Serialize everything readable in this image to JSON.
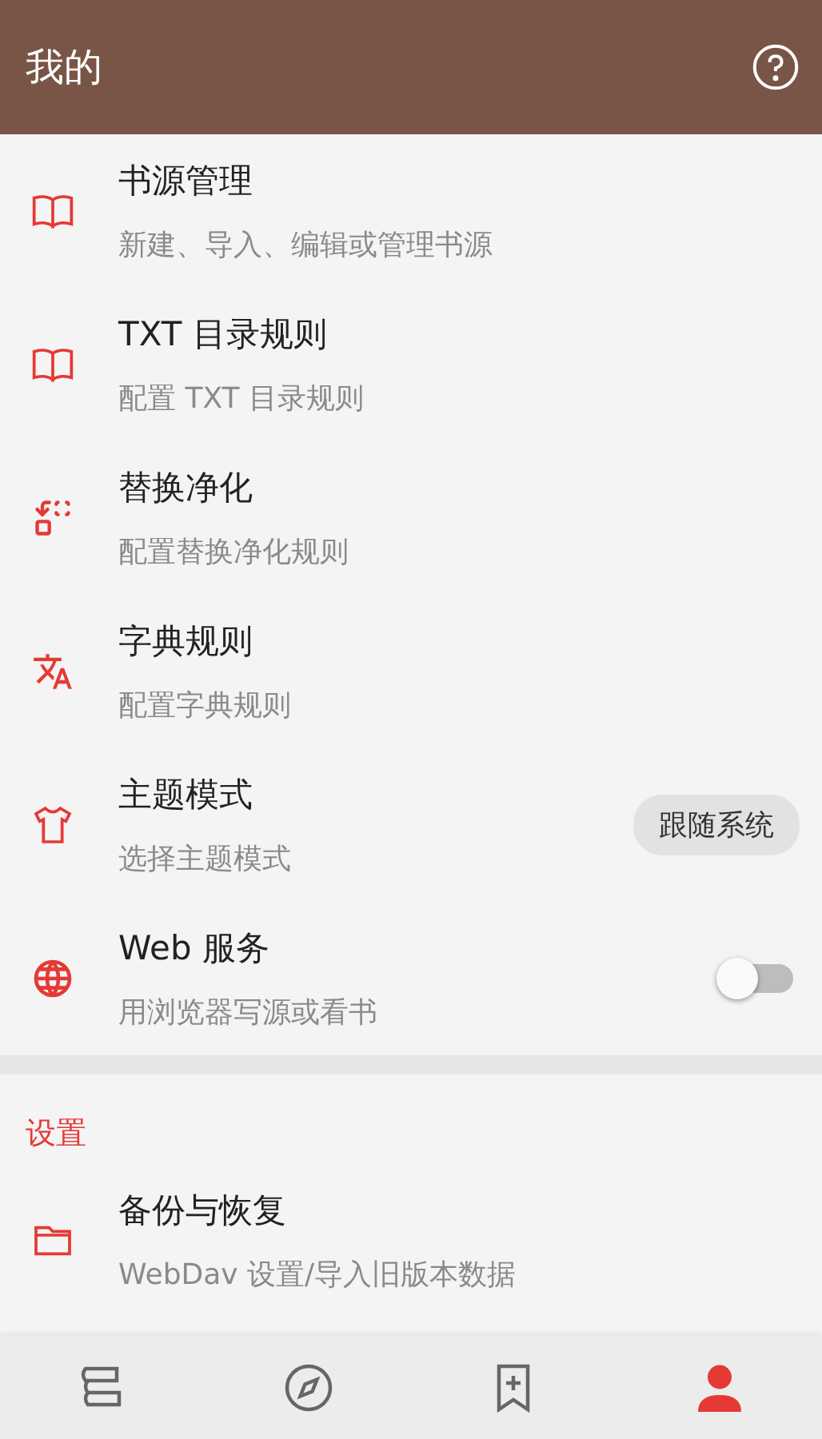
{
  "header": {
    "title": "我的"
  },
  "items": [
    {
      "kind": "plain",
      "title": "书源管理",
      "subtitle": "新建、导入、编辑或管理书源"
    },
    {
      "kind": "plain",
      "title": "TXT 目录规则",
      "subtitle": "配置 TXT 目录规则"
    },
    {
      "kind": "plain",
      "title": "替换净化",
      "subtitle": "配置替换净化规则"
    },
    {
      "kind": "plain",
      "title": "字典规则",
      "subtitle": "配置字典规则"
    },
    {
      "kind": "chip",
      "title": "主题模式",
      "subtitle": "选择主题模式",
      "value": "跟随系统"
    },
    {
      "kind": "switch",
      "title": "Web 服务",
      "subtitle": "用浏览器写源或看书",
      "on": false
    }
  ],
  "section": {
    "title": "设置"
  },
  "settings_items": [
    {
      "title": "备份与恢复",
      "subtitle": "WebDav 设置/导入旧版本数据"
    }
  ],
  "nav": [
    {
      "selected": false
    },
    {
      "selected": false
    },
    {
      "selected": false
    },
    {
      "selected": true
    }
  ]
}
